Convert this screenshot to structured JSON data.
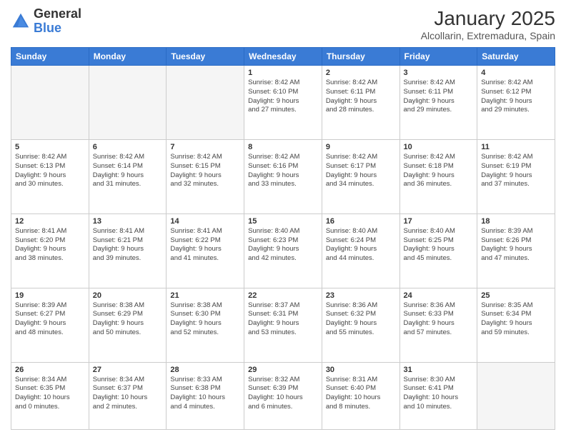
{
  "header": {
    "logo_line1": "General",
    "logo_line2": "Blue",
    "month": "January 2025",
    "location": "Alcollarin, Extremadura, Spain"
  },
  "weekdays": [
    "Sunday",
    "Monday",
    "Tuesday",
    "Wednesday",
    "Thursday",
    "Friday",
    "Saturday"
  ],
  "weeks": [
    [
      {
        "num": "",
        "info": ""
      },
      {
        "num": "",
        "info": ""
      },
      {
        "num": "",
        "info": ""
      },
      {
        "num": "1",
        "info": "Sunrise: 8:42 AM\nSunset: 6:10 PM\nDaylight: 9 hours\nand 27 minutes."
      },
      {
        "num": "2",
        "info": "Sunrise: 8:42 AM\nSunset: 6:11 PM\nDaylight: 9 hours\nand 28 minutes."
      },
      {
        "num": "3",
        "info": "Sunrise: 8:42 AM\nSunset: 6:11 PM\nDaylight: 9 hours\nand 29 minutes."
      },
      {
        "num": "4",
        "info": "Sunrise: 8:42 AM\nSunset: 6:12 PM\nDaylight: 9 hours\nand 29 minutes."
      }
    ],
    [
      {
        "num": "5",
        "info": "Sunrise: 8:42 AM\nSunset: 6:13 PM\nDaylight: 9 hours\nand 30 minutes."
      },
      {
        "num": "6",
        "info": "Sunrise: 8:42 AM\nSunset: 6:14 PM\nDaylight: 9 hours\nand 31 minutes."
      },
      {
        "num": "7",
        "info": "Sunrise: 8:42 AM\nSunset: 6:15 PM\nDaylight: 9 hours\nand 32 minutes."
      },
      {
        "num": "8",
        "info": "Sunrise: 8:42 AM\nSunset: 6:16 PM\nDaylight: 9 hours\nand 33 minutes."
      },
      {
        "num": "9",
        "info": "Sunrise: 8:42 AM\nSunset: 6:17 PM\nDaylight: 9 hours\nand 34 minutes."
      },
      {
        "num": "10",
        "info": "Sunrise: 8:42 AM\nSunset: 6:18 PM\nDaylight: 9 hours\nand 36 minutes."
      },
      {
        "num": "11",
        "info": "Sunrise: 8:42 AM\nSunset: 6:19 PM\nDaylight: 9 hours\nand 37 minutes."
      }
    ],
    [
      {
        "num": "12",
        "info": "Sunrise: 8:41 AM\nSunset: 6:20 PM\nDaylight: 9 hours\nand 38 minutes."
      },
      {
        "num": "13",
        "info": "Sunrise: 8:41 AM\nSunset: 6:21 PM\nDaylight: 9 hours\nand 39 minutes."
      },
      {
        "num": "14",
        "info": "Sunrise: 8:41 AM\nSunset: 6:22 PM\nDaylight: 9 hours\nand 41 minutes."
      },
      {
        "num": "15",
        "info": "Sunrise: 8:40 AM\nSunset: 6:23 PM\nDaylight: 9 hours\nand 42 minutes."
      },
      {
        "num": "16",
        "info": "Sunrise: 8:40 AM\nSunset: 6:24 PM\nDaylight: 9 hours\nand 44 minutes."
      },
      {
        "num": "17",
        "info": "Sunrise: 8:40 AM\nSunset: 6:25 PM\nDaylight: 9 hours\nand 45 minutes."
      },
      {
        "num": "18",
        "info": "Sunrise: 8:39 AM\nSunset: 6:26 PM\nDaylight: 9 hours\nand 47 minutes."
      }
    ],
    [
      {
        "num": "19",
        "info": "Sunrise: 8:39 AM\nSunset: 6:27 PM\nDaylight: 9 hours\nand 48 minutes."
      },
      {
        "num": "20",
        "info": "Sunrise: 8:38 AM\nSunset: 6:29 PM\nDaylight: 9 hours\nand 50 minutes."
      },
      {
        "num": "21",
        "info": "Sunrise: 8:38 AM\nSunset: 6:30 PM\nDaylight: 9 hours\nand 52 minutes."
      },
      {
        "num": "22",
        "info": "Sunrise: 8:37 AM\nSunset: 6:31 PM\nDaylight: 9 hours\nand 53 minutes."
      },
      {
        "num": "23",
        "info": "Sunrise: 8:36 AM\nSunset: 6:32 PM\nDaylight: 9 hours\nand 55 minutes."
      },
      {
        "num": "24",
        "info": "Sunrise: 8:36 AM\nSunset: 6:33 PM\nDaylight: 9 hours\nand 57 minutes."
      },
      {
        "num": "25",
        "info": "Sunrise: 8:35 AM\nSunset: 6:34 PM\nDaylight: 9 hours\nand 59 minutes."
      }
    ],
    [
      {
        "num": "26",
        "info": "Sunrise: 8:34 AM\nSunset: 6:35 PM\nDaylight: 10 hours\nand 0 minutes."
      },
      {
        "num": "27",
        "info": "Sunrise: 8:34 AM\nSunset: 6:37 PM\nDaylight: 10 hours\nand 2 minutes."
      },
      {
        "num": "28",
        "info": "Sunrise: 8:33 AM\nSunset: 6:38 PM\nDaylight: 10 hours\nand 4 minutes."
      },
      {
        "num": "29",
        "info": "Sunrise: 8:32 AM\nSunset: 6:39 PM\nDaylight: 10 hours\nand 6 minutes."
      },
      {
        "num": "30",
        "info": "Sunrise: 8:31 AM\nSunset: 6:40 PM\nDaylight: 10 hours\nand 8 minutes."
      },
      {
        "num": "31",
        "info": "Sunrise: 8:30 AM\nSunset: 6:41 PM\nDaylight: 10 hours\nand 10 minutes."
      },
      {
        "num": "",
        "info": ""
      }
    ]
  ]
}
